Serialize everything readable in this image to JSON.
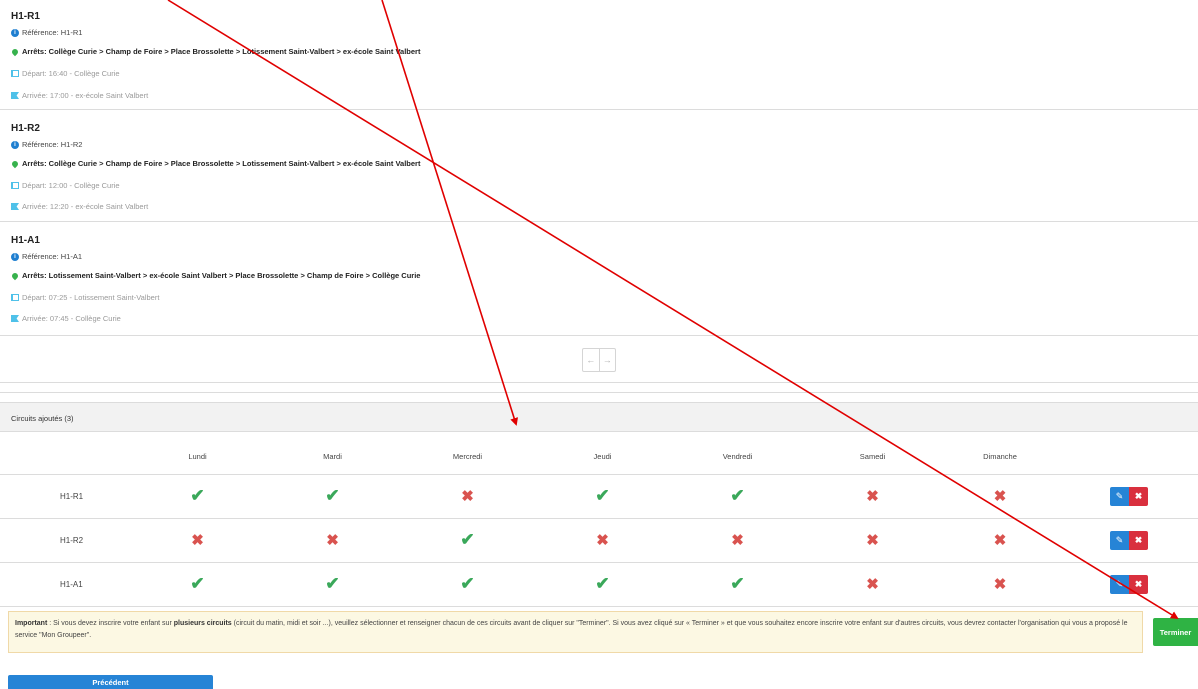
{
  "routes": [
    {
      "title": "H1-R1",
      "reference": "Référence: H1-R1",
      "stops": "Arrêts: Collège Curie > Champ de Foire > Place Brossolette > Lotissement Saint-Valbert > ex-école Saint Valbert",
      "departure": "Départ: 16:40 - Collège Curie",
      "arrival": "Arrivée: 17:00 - ex-école Saint Valbert"
    },
    {
      "title": "H1-R2",
      "reference": "Référence: H1-R2",
      "stops": "Arrêts: Collège Curie > Champ de Foire > Place Brossolette > Lotissement Saint-Valbert > ex-école Saint Valbert",
      "departure": "Départ: 12:00 - Collège Curie",
      "arrival": "Arrivée: 12:20 - ex-école Saint Valbert"
    },
    {
      "title": "H1-A1",
      "reference": "Référence: H1-A1",
      "stops": "Arrêts: Lotissement Saint-Valbert > ex-école Saint Valbert > Place Brossolette > Champ de Foire > Collège Curie",
      "departure": "Départ: 07:25 - Lotissement Saint-Valbert",
      "arrival": "Arrivée: 07:45 - Collège Curie"
    }
  ],
  "pagination": {
    "prev": "←",
    "next": "→"
  },
  "circuits": {
    "header": "Circuits ajoutés (3)",
    "days": [
      "Lundi",
      "Mardi",
      "Mercredi",
      "Jeudi",
      "Vendredi",
      "Samedi",
      "Dimanche"
    ],
    "rows": [
      {
        "name": "H1-R1",
        "days": [
          true,
          true,
          false,
          true,
          true,
          false,
          false
        ]
      },
      {
        "name": "H1-R2",
        "days": [
          false,
          false,
          true,
          false,
          false,
          false,
          false
        ]
      },
      {
        "name": "H1-A1",
        "days": [
          true,
          true,
          true,
          true,
          true,
          false,
          false
        ]
      }
    ],
    "check_symbol": "✔",
    "cross_symbol": "✖",
    "edit_symbol": "✎",
    "delete_symbol": "✖"
  },
  "notice": {
    "prefix": "Important",
    "text1": " : Si vous devez inscrire votre enfant sur ",
    "emphasis": "plusieurs circuits",
    "text2": " (circuit du matin, midi et soir ...), veuillez sélectionner et renseigner chacun de ces circuits avant de cliquer sur \"Terminer\". Si vous avez cliqué sur « Terminer » et que vous souhaitez encore inscrire votre enfant sur d'autres circuits, vous devrez contacter l'organisation qui vous a proposé le service \"Mon Groupeer\"."
  },
  "buttons": {
    "finish": "Terminer",
    "previous": "Précédent"
  },
  "colors": {
    "annotation_arrow": "#e00000",
    "check": "#3aa85a",
    "cross": "#d9534f",
    "finish": "#2fb344",
    "primary": "#2684d6"
  }
}
